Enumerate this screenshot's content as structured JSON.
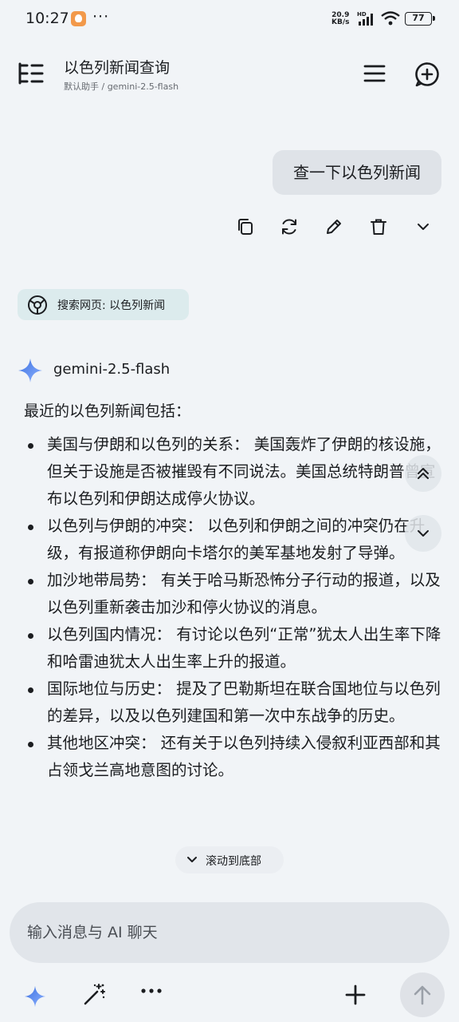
{
  "status_bar": {
    "time": "10:27",
    "more": "···",
    "net_speed_value": "20.9",
    "net_speed_unit": "KB/s",
    "net_type": "HD",
    "battery": "77"
  },
  "header": {
    "title": "以色列新闻查询",
    "subtitle": "默认助手 / gemini-2.5-flash"
  },
  "user_message": {
    "text": "查一下以色列新闻",
    "actions": [
      "copy-icon",
      "regenerate-icon",
      "edit-icon",
      "delete-icon",
      "expand-icon"
    ]
  },
  "search_chip": {
    "label": "搜索网页: 以色列新闻"
  },
  "assistant": {
    "model_name": "gemini-2.5-flash",
    "intro": "最近的以色列新闻包括：",
    "items": [
      {
        "title": "美国与伊朗和以色列的关系：",
        "body": "美国轰炸了伊朗的核设施，但关于设施是否被摧毁有不同说法。美国总统特朗普曾宣布以色列和伊朗达成停火协议。"
      },
      {
        "title": "以色列与伊朗的冲突：",
        "body": "以色列和伊朗之间的冲突仍在升级，有报道称伊朗向卡塔尔的美军基地发射了导弹。"
      },
      {
        "title": "加沙地带局势：",
        "body": "有关于哈马斯恐怖分子行动的报道，以及以色列重新袭击加沙和停火协议的消息。"
      },
      {
        "title": "以色列国内情况：",
        "body": "有讨论以色列“正常”犹太人出生率下降和哈雷迪犹太人出生率上升的报道。"
      },
      {
        "title": "国际地位与历史：",
        "body": "提及了巴勒斯坦在联合国地位与以色列的差异，以及以色列建国和第一次中东战争的历史。"
      },
      {
        "title": "其他地区冲突：",
        "body": "还有关于以色列持续入侵叙利亚西部和其占领戈兰高地意图的讨论。"
      }
    ]
  },
  "scroll_to_bottom": "滚动到底部",
  "input": {
    "placeholder": "输入消息与 AI 聊天",
    "value": ""
  },
  "colors": {
    "background": "#f1f4f7",
    "bubble": "#dfe3e8",
    "search_chip": "#dcebed",
    "input_box": "#e1e5ea",
    "gemini_blue": "#4a7de8"
  }
}
